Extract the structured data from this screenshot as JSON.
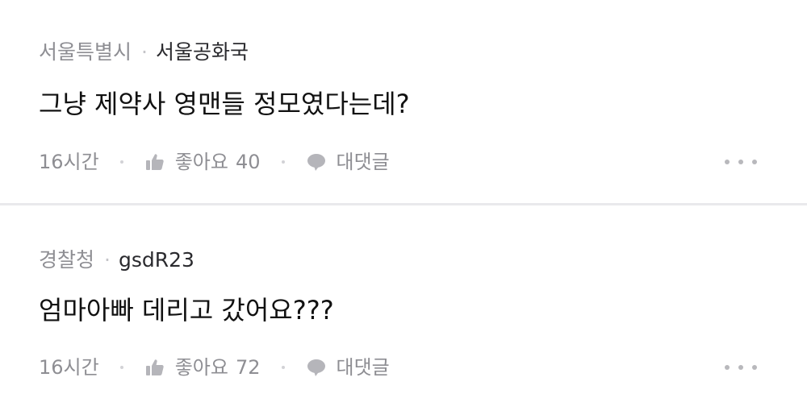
{
  "comments": [
    {
      "group": "서울특별시",
      "separator": "·",
      "username": "서울공화국",
      "text": "그냥 제약사 영맨들 정모였다는데?",
      "time": "16시간",
      "like_label": "좋아요",
      "like_count": "40",
      "reply_label": "대댓글",
      "like_icon": "thumbs-up-icon",
      "reply_icon": "speech-bubble-icon",
      "more_icon": "more-dots-icon"
    },
    {
      "group": "경찰청",
      "separator": "·",
      "username": "gsdR23",
      "text": "엄마아빠 데리고 갔어요???",
      "time": "16시간",
      "like_label": "좋아요",
      "like_count": "72",
      "reply_label": "대댓글",
      "like_icon": "thumbs-up-icon",
      "reply_icon": "speech-bubble-icon",
      "more_icon": "more-dots-icon"
    }
  ],
  "colors": {
    "meta_gray": "#8e8e93",
    "text_dark": "#111111",
    "divider": "#e9e9ec"
  }
}
